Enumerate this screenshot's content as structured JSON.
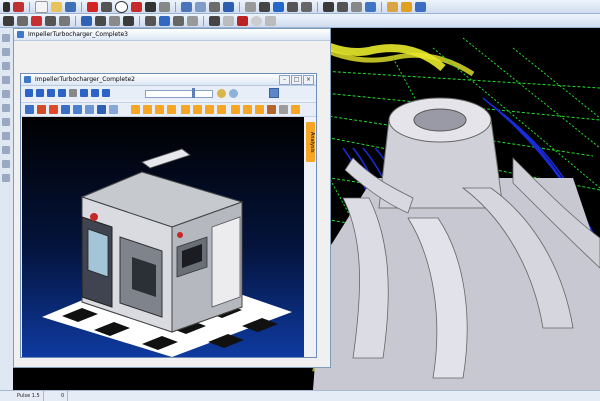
{
  "outer_window": {
    "title": "ImpellerTurbocharger_Complete3"
  },
  "inner_window": {
    "title": "ImpellerTurbocharger_Complete2",
    "side_tab": "Analysis"
  },
  "speed_slider": {
    "level": 0.7
  },
  "statusbar": {
    "tab1": "Pulse 1.5",
    "tab2": "0"
  },
  "colors": {
    "toolpath_blue": "#1a2bdc",
    "toolpath_green": "#22e02a",
    "stock_yellow": "#e8ea2a",
    "accent_orange": "#f6a524"
  },
  "icons": [
    "select-icon",
    "pointer-icon",
    "rotate-icon",
    "zoom-icon",
    "pan-icon",
    "fit-icon",
    "wireframe-icon",
    "shaded-icon",
    "play-icon",
    "pause-icon",
    "rewind-icon",
    "fast-forward-icon",
    "stop-icon",
    "loop-icon",
    "close-icon",
    "minimize-icon",
    "maximize-icon",
    "help-icon"
  ]
}
